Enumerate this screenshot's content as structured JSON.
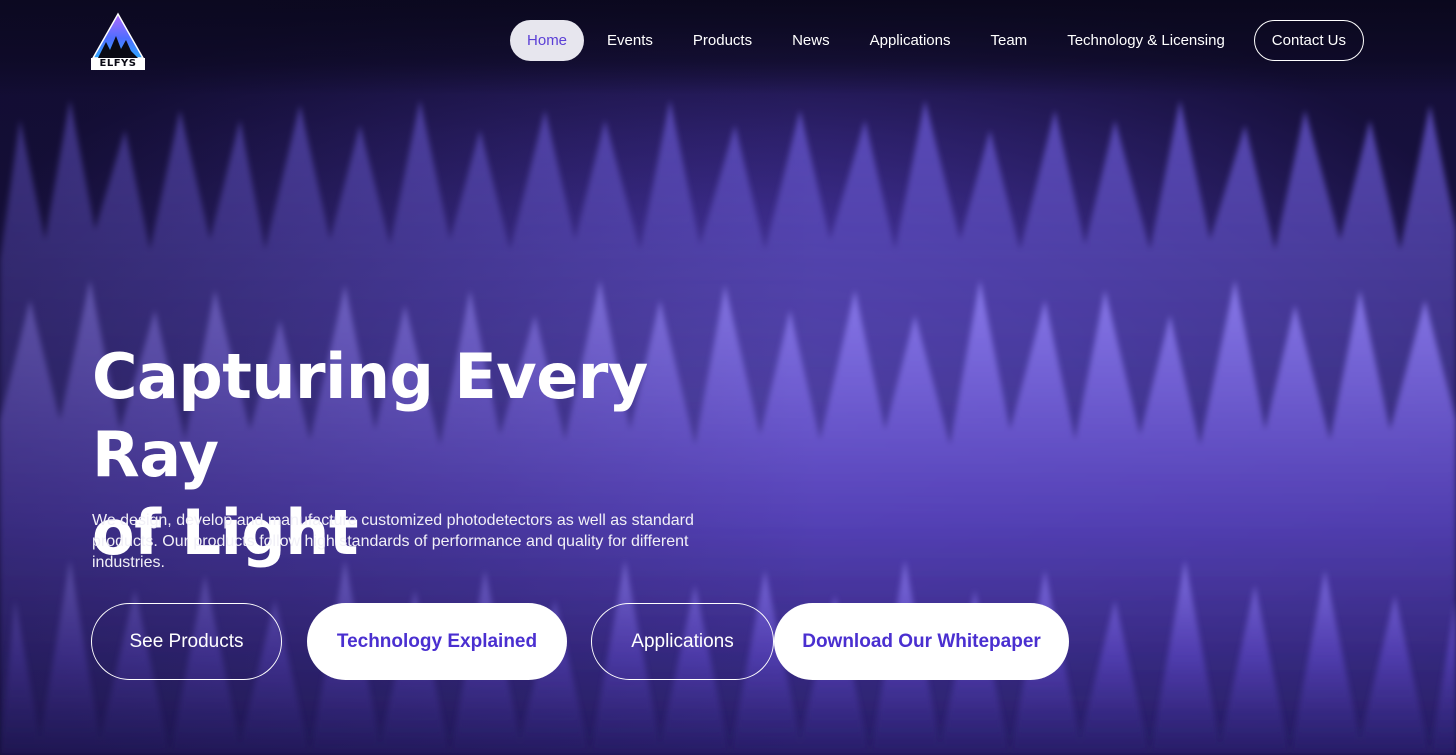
{
  "brand": {
    "name": "ELFYS"
  },
  "nav": {
    "items": [
      {
        "label": "Home",
        "active": true
      },
      {
        "label": "Events"
      },
      {
        "label": "Products"
      },
      {
        "label": "News"
      },
      {
        "label": "Applications"
      },
      {
        "label": "Team"
      },
      {
        "label": "Technology & Licensing"
      }
    ],
    "contact_label": "Contact Us"
  },
  "hero": {
    "title_line1": "Capturing Every Ray",
    "title_line2": "of Light",
    "subtitle": "We design, develop and manufacture customized photodetectors as well as standard products. Our products follow high standards of performance and quality for different industries.",
    "buttons": [
      {
        "label": "See Products",
        "style": "outline"
      },
      {
        "label": "Technology Explained",
        "style": "solid"
      },
      {
        "label": "Applications",
        "style": "outline"
      },
      {
        "label": "Download Our Whitepaper",
        "style": "solid"
      }
    ]
  },
  "colors": {
    "accent": "#4a2fd0",
    "background": "#2a1f66",
    "nav_active_bg": "#e7e6ee"
  }
}
